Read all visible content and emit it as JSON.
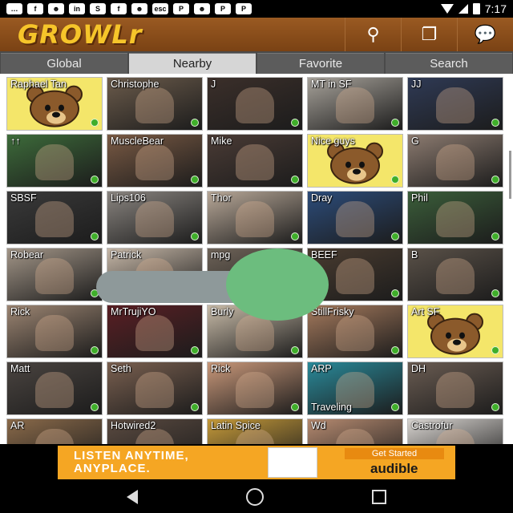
{
  "status_bar": {
    "time": "7:17",
    "icons": [
      "chat-bubble-icon",
      "facebook-icon",
      "growlr-bear-icon",
      "linkedin-icon",
      "skype-icon",
      "facebook-icon",
      "growlr-bear-icon",
      "esc-icon",
      "pinterest-icon",
      "growlr-bear-icon",
      "pinterest-icon",
      "pinterest-icon"
    ],
    "icon_glyphs": [
      "…",
      "f",
      "☻",
      "in",
      "S",
      "f",
      "☻",
      "esc",
      "P",
      "☻",
      "P",
      "P"
    ]
  },
  "app_bar": {
    "logo": "GROWLr",
    "actions": [
      {
        "name": "search-icon",
        "glyph": "⚲"
      },
      {
        "name": "windows-icon",
        "glyph": "❐"
      },
      {
        "name": "chat-icon",
        "glyph": "💬"
      }
    ]
  },
  "tabs": [
    {
      "label": "Global",
      "active": false
    },
    {
      "label": "Nearby",
      "active": true
    },
    {
      "label": "Favorite",
      "active": false
    },
    {
      "label": "Search",
      "active": false
    }
  ],
  "grid": [
    {
      "name": "Raphael Tan",
      "bear": true,
      "online": true
    },
    {
      "name": "Christophe",
      "color": "#6b5b4b",
      "online": true
    },
    {
      "name": "J",
      "color": "#3b2f2a",
      "online": true
    },
    {
      "name": "MT in SF",
      "color": "#a7a29a",
      "online": true
    },
    {
      "name": "JJ",
      "color": "#2f3a55",
      "online": true
    },
    {
      "name": "↑↑",
      "color": "#3d6b3a",
      "online": true
    },
    {
      "name": "MuscleBear",
      "color": "#7a5a44",
      "online": true
    },
    {
      "name": "Mike",
      "color": "#4a3b35",
      "online": true
    },
    {
      "name": "Nice guys",
      "bear": true,
      "online": true
    },
    {
      "name": "G",
      "color": "#8c7b70",
      "online": true
    },
    {
      "name": "SBSF",
      "color": "#3a3a3a",
      "online": true
    },
    {
      "name": "Lips106",
      "color": "#8a8580",
      "online": true
    },
    {
      "name": "Thor",
      "color": "#b8a898",
      "online": true
    },
    {
      "name": "Dray",
      "color": "#2c4c7a",
      "online": true
    },
    {
      "name": "Phil",
      "color": "#3b5e3a",
      "online": true
    },
    {
      "name": "Robear",
      "color": "#a39688",
      "online": true
    },
    {
      "name": "Patrick",
      "color": "#c7b8a8",
      "online": true
    },
    {
      "name": "mpg",
      "color": "#6e6358",
      "online": true
    },
    {
      "name": "BEEF",
      "color": "#4a3c30",
      "online": true
    },
    {
      "name": "B",
      "color": "#5a5148",
      "online": true
    },
    {
      "name": "Rick",
      "color": "#9c8572",
      "online": true
    },
    {
      "name": "MrTrujiYO",
      "color": "#5a1f24",
      "online": true
    },
    {
      "name": "Burly",
      "color": "#c8bba8",
      "online": true
    },
    {
      "name": "StillFrisky",
      "color": "#a57a5d",
      "online": true
    },
    {
      "name": "Art SF",
      "bear": true,
      "online": true
    },
    {
      "name": "Matt",
      "color": "#4a4440",
      "online": true
    },
    {
      "name": "Seth",
      "color": "#7a6050",
      "online": true
    },
    {
      "name": "Rick",
      "color": "#c9987a",
      "online": true
    },
    {
      "name": "ARP",
      "sub": "Traveling",
      "color": "#2a8a9a",
      "online": true
    },
    {
      "name": "DH",
      "color": "#6a5c52",
      "online": true
    },
    {
      "name": "AR",
      "color": "#8a6a4a",
      "online": false
    },
    {
      "name": "Hotwired2",
      "color": "#5a4a40",
      "online": false
    },
    {
      "name": "Latin Spice",
      "color": "#c59a3a",
      "online": false
    },
    {
      "name": "Wd",
      "color": "#b58a70",
      "online": false
    },
    {
      "name": "Castrofur",
      "color": "#d8d4d0",
      "online": false
    }
  ],
  "ad": {
    "headline": "LISTEN ANYTIME, ANYPLACE.",
    "cta": "Get Started",
    "brand": "audible"
  },
  "nav": {
    "back": "back-icon",
    "home": "home-icon",
    "recents": "recents-icon"
  }
}
